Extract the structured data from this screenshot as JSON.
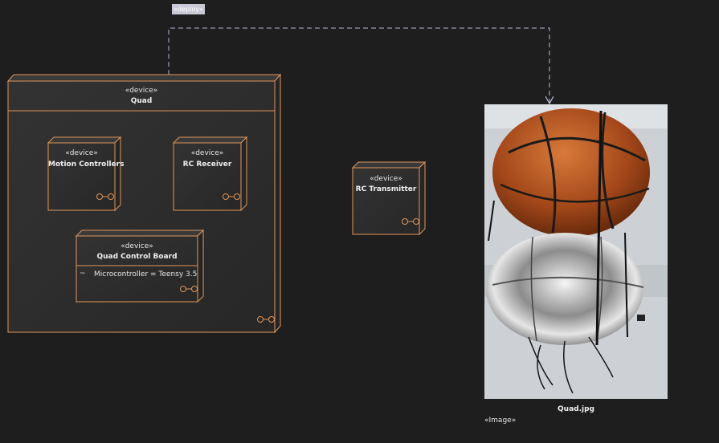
{
  "connector": {
    "stereotype": "«deploy»"
  },
  "quad": {
    "stereotype": "«device»",
    "name": "Quad"
  },
  "motion_controllers": {
    "stereotype": "«device»",
    "name": "Motion Controllers"
  },
  "rc_receiver": {
    "stereotype": "«device»",
    "name": "RC Receiver"
  },
  "quad_control_board": {
    "stereotype": "«device»",
    "name": "Quad Control Board",
    "property_marker": "~",
    "property": "Microcontroller = Teensy 3.5"
  },
  "rc_transmitter": {
    "stereotype": "«device»",
    "name": "RC Transmitter"
  },
  "image_artifact": {
    "name": "Quad.jpg",
    "stereotype": "«Image»"
  },
  "colors": {
    "background": "#1e1e1e",
    "node_border": "#e0965a",
    "node_fill": "#2d2d2d",
    "connector": "#b4b8d8"
  }
}
